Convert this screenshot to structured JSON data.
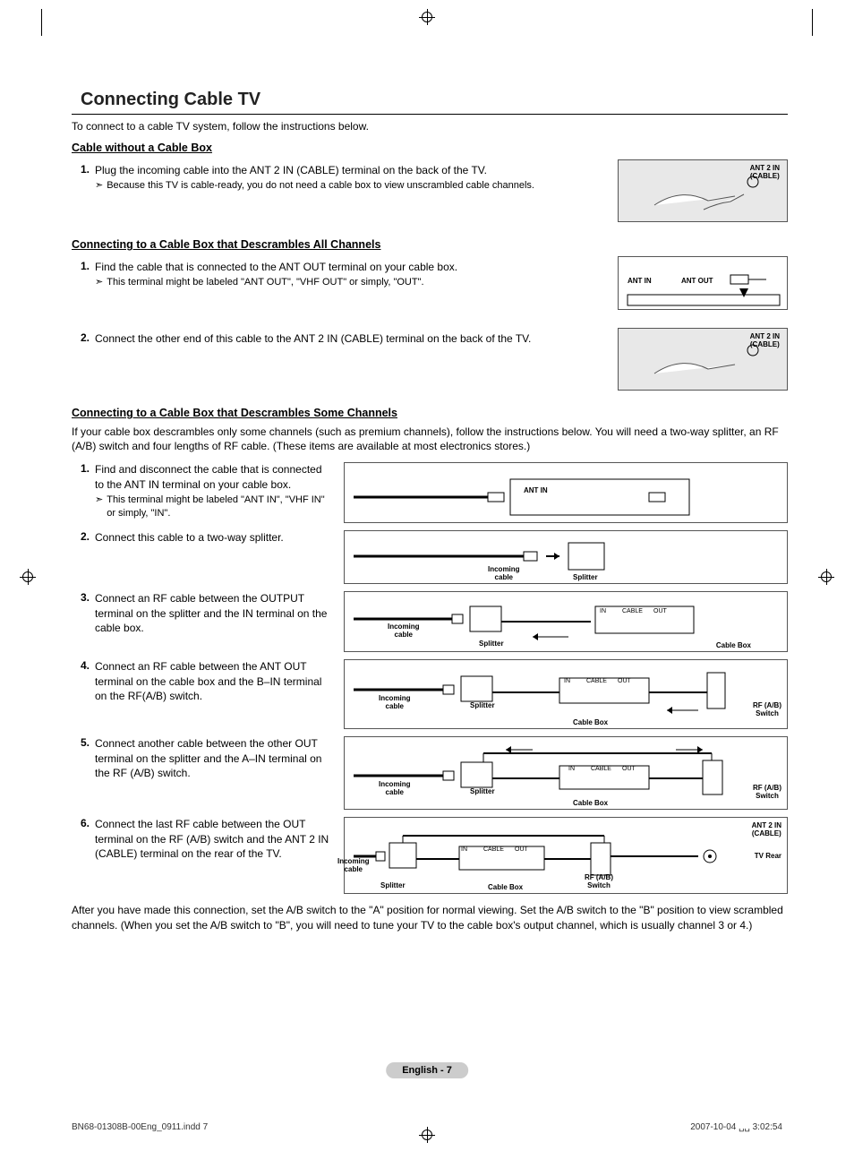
{
  "title": "Connecting Cable TV",
  "intro": "To connect to a cable TV system, follow the instructions below.",
  "sec1": {
    "heading": "Cable without a Cable Box",
    "step1_num": "1.",
    "step1": "Plug the incoming cable into the ANT 2 IN (CABLE) terminal on the back of the TV.",
    "note1": "Because this TV is cable-ready, you do not need a cable box to view unscrambled cable channels.",
    "diag_label": "ANT 2 IN\n(CABLE)"
  },
  "sec2": {
    "heading": "Connecting to a Cable Box that Descrambles All Channels",
    "step1_num": "1.",
    "step1": "Find the cable that is connected to the ANT OUT terminal on your cable box.",
    "note1": "This terminal might be labeled \"ANT OUT\", \"VHF OUT\" or simply, \"OUT\".",
    "step2_num": "2.",
    "step2": "Connect the other end of this cable to the ANT 2 IN (CABLE) terminal on the back of the TV.",
    "diag1_l1": "ANT IN",
    "diag1_l2": "ANT OUT",
    "diag2_label": "ANT 2 IN\n(CABLE)"
  },
  "sec3": {
    "heading": "Connecting to a Cable Box that Descrambles Some Channels",
    "intro": "If your cable box descrambles only some channels (such as premium channels), follow the instructions below. You will need a two-way splitter, an RF (A/B) switch and four lengths of RF cable. (These items are available at most electronics stores.)",
    "step1_num": "1.",
    "step1": "Find and disconnect the cable that is connected to the ANT IN terminal on your cable box.",
    "note1": "This terminal might be labeled \"ANT IN\", \"VHF IN\" or simply, \"IN\".",
    "step2_num": "2.",
    "step2": "Connect this cable to a two-way splitter.",
    "step3_num": "3.",
    "step3": "Connect an RF cable between the OUTPUT terminal on the splitter and the IN terminal on the cable box.",
    "step4_num": "4.",
    "step4": "Connect an RF cable between the ANT OUT terminal on the cable box and the B–IN terminal on the RF(A/B) switch.",
    "step5_num": "5.",
    "step5": "Connect another cable between the other OUT terminal on the splitter and the A–IN terminal on the RF (A/B) switch.",
    "step6_num": "6.",
    "step6": "Connect the last RF cable between the OUT terminal on the RF (A/B) switch and the ANT 2 IN (CABLE) terminal on the rear of the TV.",
    "outro": "After you have made this connection, set the A/B switch to the \"A\" position for normal viewing. Set the A/B switch to the \"B\" position to view scrambled channels. (When you set the A/B switch to \"B\", you will need to tune your TV to the cable box's output channel, which is usually channel 3 or 4.)",
    "labels": {
      "ant_in": "ANT IN",
      "incoming": "Incoming\ncable",
      "splitter": "Splitter",
      "cable_box": "Cable Box",
      "rf_switch": "RF (A/B)\nSwitch",
      "in": "IN",
      "cable": "CABLE",
      "out": "OUT",
      "tv_rear": "TV Rear",
      "ant2in": "ANT 2 IN\n(CABLE)"
    }
  },
  "page_footer": "English - 7",
  "doc_footer_left": "BN68-01308B-00Eng_0911.indd   7",
  "doc_footer_right": "2007-10-04   ␣␣ 3:02:54"
}
